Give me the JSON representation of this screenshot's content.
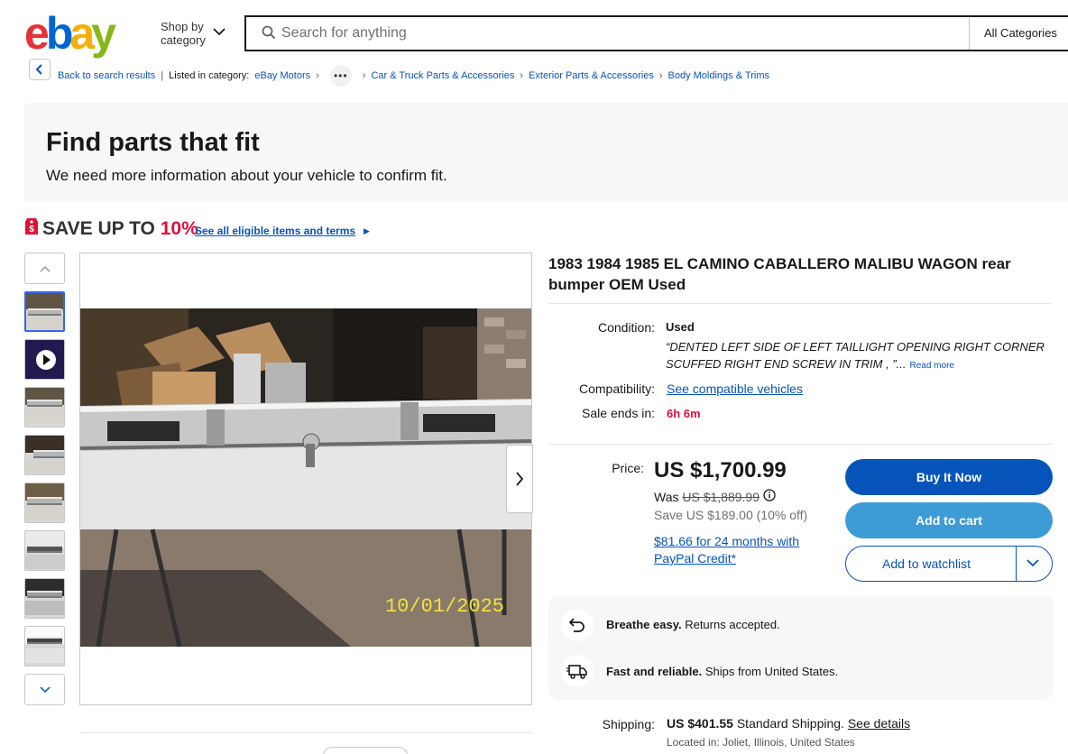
{
  "header": {
    "logo": [
      "e",
      "b",
      "a",
      "y"
    ],
    "shop_by_line1": "Shop by",
    "shop_by_line2": "category",
    "search_placeholder": "Search for anything",
    "all_categories": "All Categories"
  },
  "breadcrumb": {
    "back": "Back to search results",
    "listed_in": "Listed in category:",
    "items": [
      "eBay Motors",
      "Car & Truck Parts & Accessories",
      "Exterior Parts & Accessories",
      "Body Moldings & Trims"
    ],
    "more": "•••"
  },
  "fit_banner": {
    "title": "Find parts that fit",
    "subtitle": "We need more information about your vehicle to confirm fit."
  },
  "promo": {
    "save_prefix": "SAVE UP TO ",
    "save_pct": "10%",
    "link": "See all eligible items and terms"
  },
  "photo": {
    "date_stamp": "10/01/2025"
  },
  "listing": {
    "title": "1983 1984 1985 EL CAMINO CABALLERO MALIBU WAGON rear bumper OEM Used",
    "condition_label": "Condition:",
    "condition_value": "Used",
    "condition_quote": "“DENTED LEFT SIDE OF LEFT TAILLIGHT OPENING RIGHT CORNER SCUFFED RIGHT END SCREW IN TRIM , ”...",
    "read_more": "Read more",
    "compat_label": "Compatibility:",
    "compat_link": "See compatible vehicles",
    "sale_label": "Sale ends in:",
    "sale_value": "6h 6m"
  },
  "price": {
    "label": "Price:",
    "value": "US $1,700.99",
    "was_prefix": "Was ",
    "was_value": "US $1,889.99",
    "save": "Save US $189.00 (10% off)",
    "paypal": "$81.66 for 24 months with PayPal Credit*"
  },
  "buttons": {
    "buy": "Buy It Now",
    "cart": "Add to cart",
    "watch": "Add to watchlist"
  },
  "assurance": {
    "returns_bold": "Breathe easy.",
    "returns_rest": " Returns accepted.",
    "ship_bold": "Fast and reliable.",
    "ship_rest": " Ships from United States."
  },
  "shipping": {
    "label": "Shipping:",
    "cost": "US $401.55",
    "method": " Standard Shipping. ",
    "details": "See details",
    "location": "Located in: Joliet, Illinois, United States"
  },
  "colors": {
    "link": "#0654ba",
    "accent_red": "#e0103a",
    "buy_button": "#0654ba",
    "cart_button": "#3d9bd5"
  }
}
